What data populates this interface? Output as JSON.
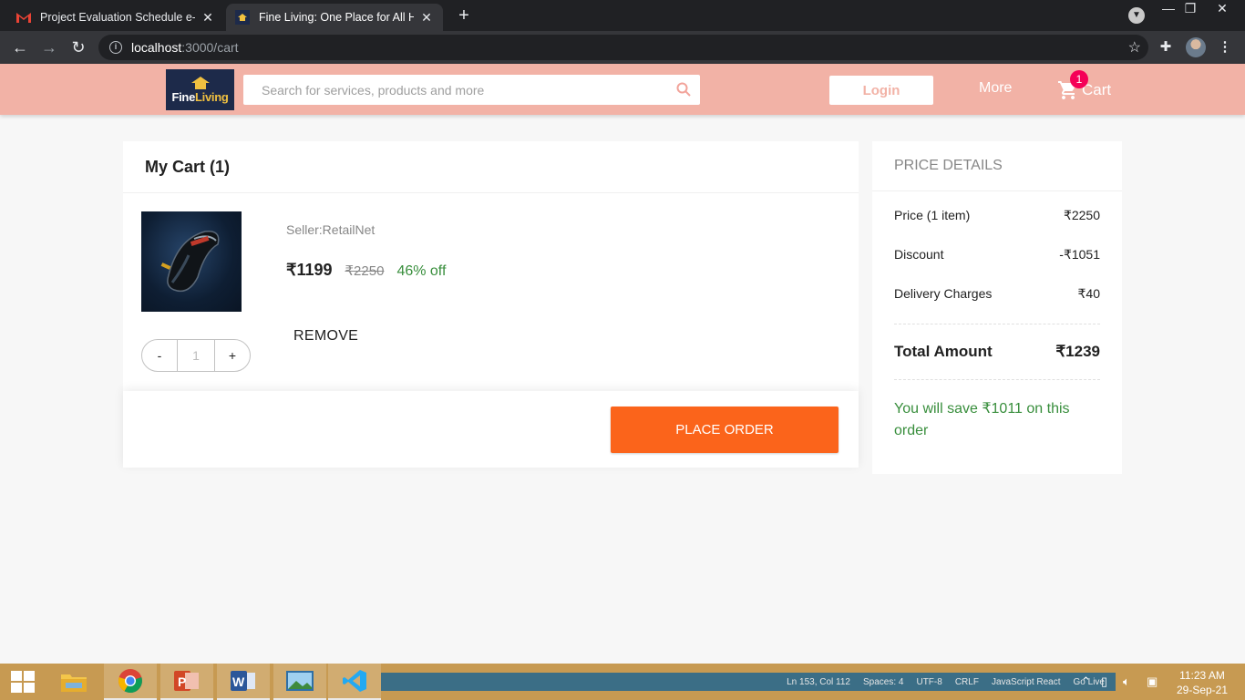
{
  "browser": {
    "tabs": [
      {
        "title": "Project Evaluation Schedule e-DA",
        "active": false
      },
      {
        "title": "Fine Living: One Place for All Hou",
        "active": true
      }
    ],
    "url_host": "localhost",
    "url_path": ":3000/cart"
  },
  "header": {
    "logo_word_1": "Fine",
    "logo_word_2": "Living",
    "search_placeholder": "Search for services, products and more",
    "login_label": "Login",
    "more_label": "More",
    "cart_label": "Cart",
    "cart_count": "1"
  },
  "cart": {
    "title": "My Cart (1)",
    "items": [
      {
        "seller": "Seller:RetailNet",
        "price": "₹1199",
        "mrp": "₹2250",
        "discount": "46% off",
        "quantity": "1",
        "minus_label": "-",
        "plus_label": "+",
        "remove_label": "REMOVE"
      }
    ],
    "place_order_label": "PLACE ORDER"
  },
  "price_details": {
    "title": "PRICE DETAILS",
    "rows": [
      {
        "label": "Price (1 item)",
        "value": "₹2250"
      },
      {
        "label": "Discount",
        "value": "-₹1051"
      },
      {
        "label": "Delivery Charges",
        "value": "₹40"
      }
    ],
    "total_label": "Total Amount",
    "total_value": "₹1239",
    "savings_text": "You will save ₹1011 on this order"
  },
  "taskbar": {
    "status_items": [
      "Ln 153, Col 112",
      "Spaces: 4",
      "UTF-8",
      "CRLF",
      "JavaScript React",
      "Go Live"
    ],
    "time": "11:23 AM",
    "date": "29-Sep-21"
  },
  "colors": {
    "header_bg": "#f2b2a6",
    "place_order": "#fb641b",
    "discount_green": "#388e3c",
    "badge": "#f50057"
  }
}
